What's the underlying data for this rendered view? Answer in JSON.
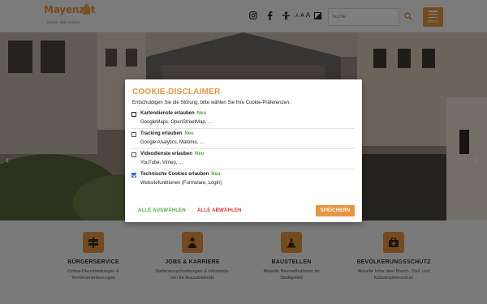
{
  "header": {
    "logo_text": "Mayenzet",
    "logo_tagline": "klein, mit schön",
    "icons": [
      "instagram-icon",
      "facebook-icon",
      "accessibility-icon",
      "text-size-icon",
      "contrast-icon",
      "search-icon",
      "menu-icon"
    ],
    "text_size": {
      "s1": "A",
      "s2": "A",
      "s3": "A"
    },
    "search_placeholder": "Suche",
    "menu_label": "Menü"
  },
  "hero": {
    "prev_arrow": "‹",
    "next_arrow": "›"
  },
  "services": [
    {
      "icon": "signpost-icon",
      "title": "BÜRGERSERVICE",
      "desc_line1": "Online-Dienstleistungen &",
      "desc_line2": "Terminvereinbarungen"
    },
    {
      "icon": "worker-icon",
      "title": "JOBS & KARRIERE",
      "desc_line1": "Stellenausschreibungen & Informatio-",
      "desc_line2": "nen für Auszubildende"
    },
    {
      "icon": "traffic-cone-icon",
      "title": "BAUSTELLEN",
      "desc_line1": "Aktuelle Baumaßnahmen im",
      "desc_line2": "Stadtgebiet"
    },
    {
      "icon": "first-aid-kit-icon",
      "title": "BEVÖLKERUNGSSCHUTZ",
      "desc_line1": "Aktuelle Infos über Brand-, Zivil- und",
      "desc_line2": "Katastrophenschutz"
    }
  ],
  "cookie": {
    "title": "COOKIE-DISCLAIMER",
    "intro": "Entschuldigen Sie die Störung, bitte wählen Sie Ihre Cookie-Präferenzen.",
    "new_badge": "Neu",
    "options": [
      {
        "label": "Kartendienste erlauben",
        "sub": "GoogleMaps, OpenStreetMap, ...",
        "checked": false
      },
      {
        "label": "Tracking erlauben",
        "sub": "Google Analytics, Matomo, ...",
        "checked": false
      },
      {
        "label": "Videodienste erlauben",
        "sub": "YouTube, Vimeo, ...",
        "checked": false
      },
      {
        "label": "Technische Cookies erlauben",
        "sub": "Websitefunktionen (Formulare, Login)",
        "checked": true
      }
    ],
    "select_all": "ALLE AUSWÄHLEN",
    "deselect_all": "ALLE ABWÄHLEN",
    "save": "SPEICHERN"
  },
  "colors": {
    "accent": "#e9973f",
    "select_all": "#4caf3a",
    "deselect_all": "#d9342b",
    "checkbox_checked": "#2f6fd8"
  }
}
